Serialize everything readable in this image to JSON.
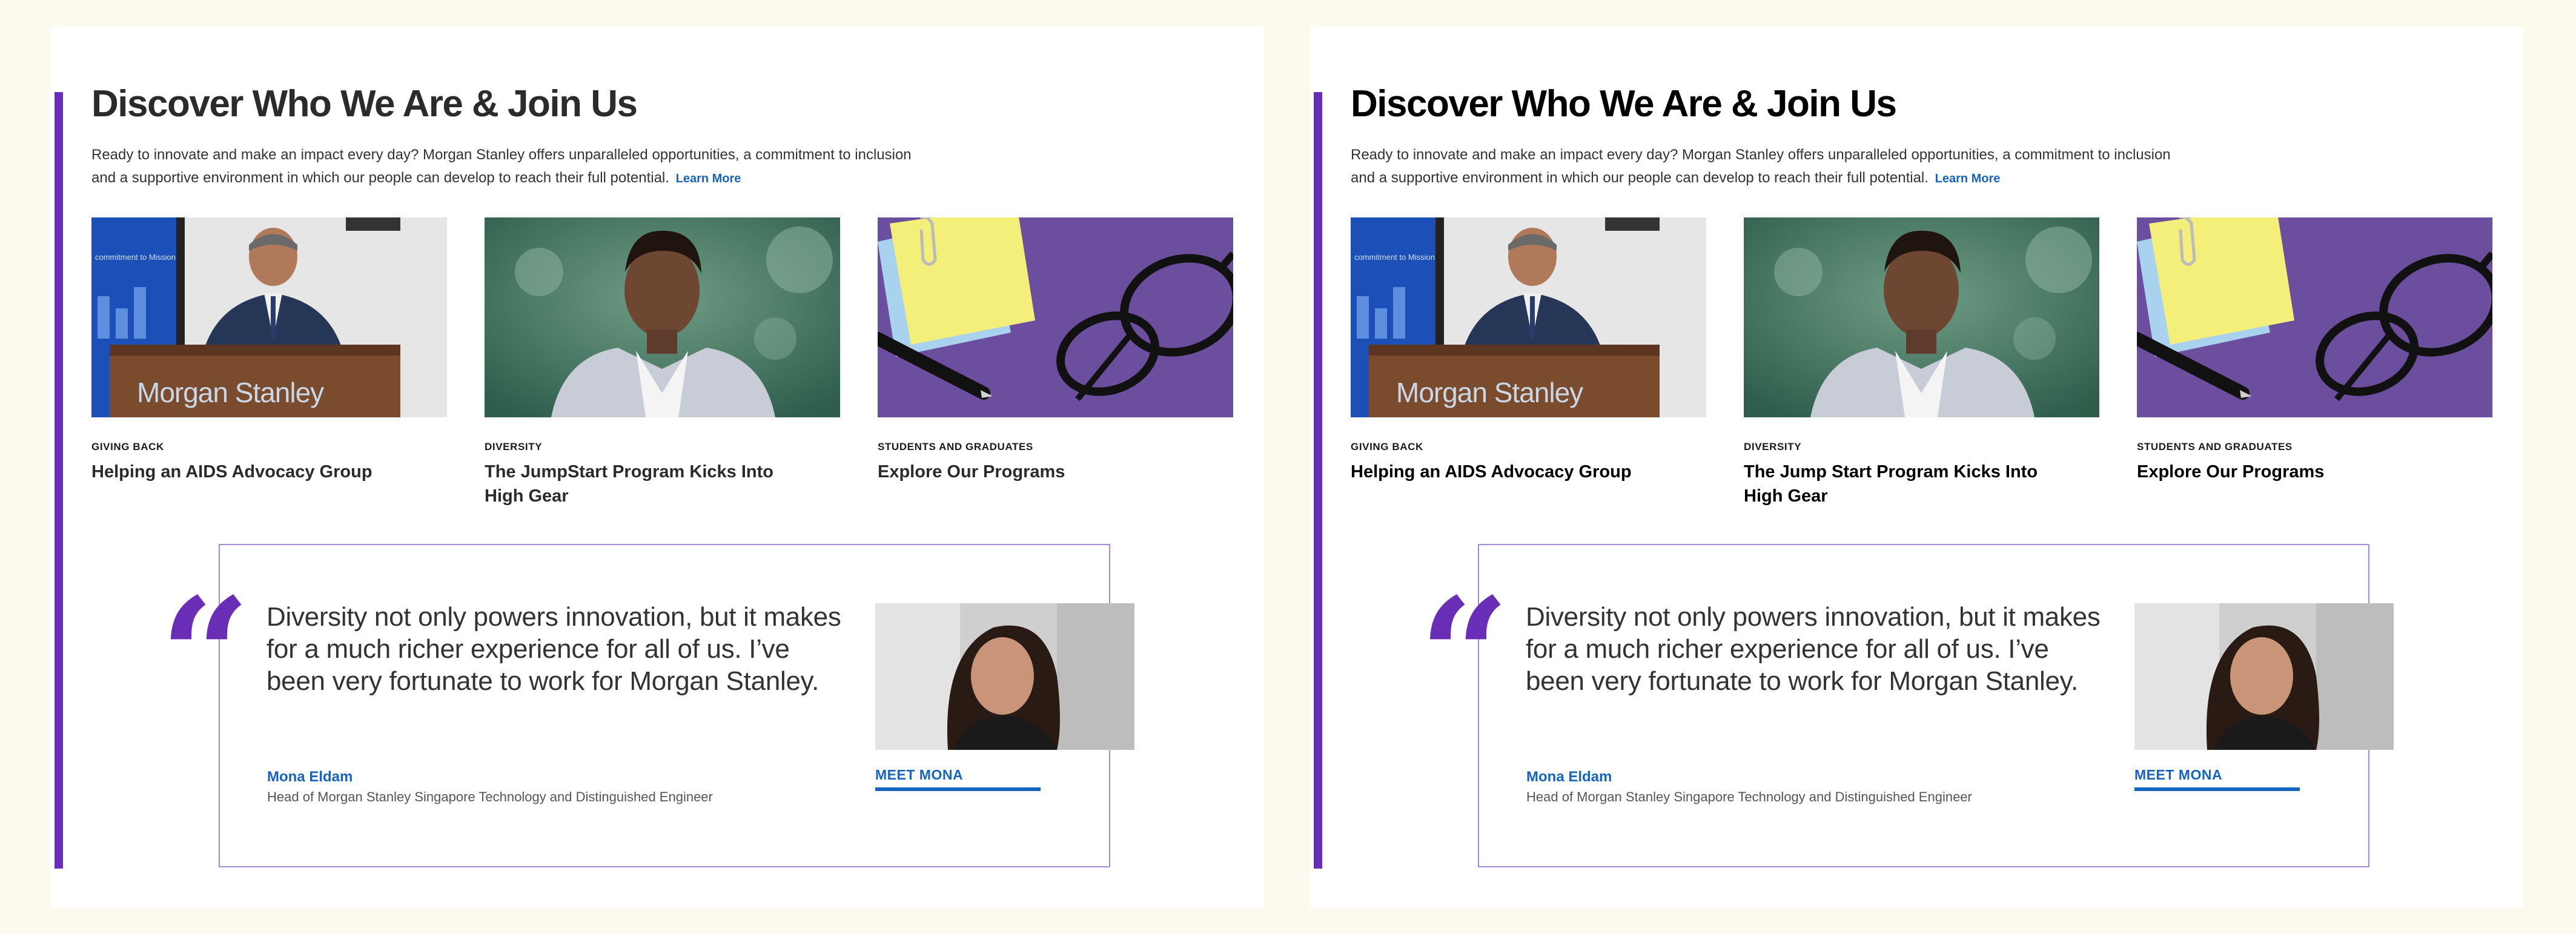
{
  "colors": {
    "page_bg": "#fcfaef",
    "accent_purple": "#6a2db5",
    "link_blue": "#1565c0",
    "quote_border": "#a889d8"
  },
  "panels": [
    {
      "heading": "Discover Who We Are & Join Us",
      "intro_line1": "Ready to innovate and make an impact every day? Morgan Stanley offers unparalleled opportunities, a commitment to inclusion",
      "intro_line2": "and a supportive environment in which our people can develop to reach their full potential.",
      "learn_more": "Learn More",
      "cards": [
        {
          "category": "GIVING BACK",
          "title": "Helping an AIDS Advocacy Group",
          "podium_text": "Morgan Stanley",
          "screen_text": "commitment to Mission"
        },
        {
          "category": "DIVERSITY",
          "title": "The JumpStart Program Kicks Into High Gear"
        },
        {
          "category": "STUDENTS AND GRADUATES",
          "title": "Explore Our Programs"
        }
      ],
      "quote": {
        "mark": "“",
        "text": "Diversity not only powers innovation, but it makes for a much richer experience for all of us. I’ve been very fortunate to work for Morgan Stanley.",
        "name": "Mona Eldam",
        "role": "Head of Morgan Stanley Singapore Technology and Distinguished Engineer",
        "cta": "MEET MONA"
      }
    },
    {
      "heading": "Discover Who We Are & Join Us",
      "intro_line1": "Ready to innovate and make an impact every day? Morgan Stanley offers unparalleled opportunities, a commitment to inclusion",
      "intro_line2": "and a supportive environment in which our people can develop to reach their full potential.",
      "learn_more": "Learn More",
      "cards": [
        {
          "category": "GIVING BACK",
          "title": "Helping an AIDS Advocacy Group",
          "podium_text": "Morgan Stanley",
          "screen_text": "commitment to Mission"
        },
        {
          "category": "DIVERSITY",
          "title": "The Jump Start Program Kicks Into High Gear"
        },
        {
          "category": "STUDENTS AND GRADUATES",
          "title": "Explore Our Programs"
        }
      ],
      "quote": {
        "mark": "“",
        "text": "Diversity not only powers innovation, but it makes for a much richer experience for all of us. I’ve been very fortunate to work for Morgan Stanley.",
        "name": "Mona Eldam",
        "role": "Head of Morgan Stanley Singapore Technology and Distinguished Engineer",
        "cta": "MEET MONA"
      }
    }
  ]
}
